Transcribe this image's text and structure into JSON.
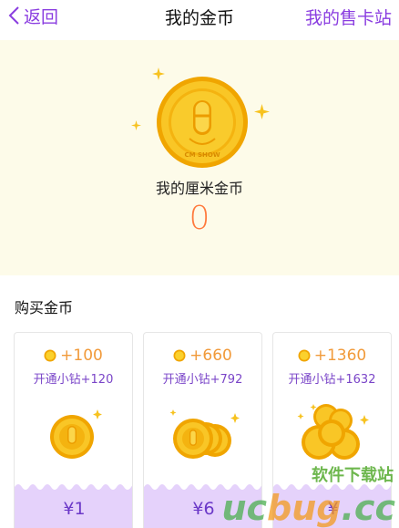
{
  "nav": {
    "back_label": "返回",
    "title": "我的金币",
    "right_label": "我的售卡站"
  },
  "hero": {
    "label": "我的厘米金币",
    "value": "0",
    "coin_text": "CM SHOW"
  },
  "section": {
    "title": "购买金币"
  },
  "cards": [
    {
      "amount": "+100",
      "sub": "开通小钻+120",
      "price": "¥1"
    },
    {
      "amount": "+660",
      "sub": "开通小钻+792",
      "price": "¥6"
    },
    {
      "amount": "+1360",
      "sub": "开通小钻+1632",
      "price": "¥"
    }
  ],
  "watermark": {
    "line1": "软件下载站",
    "line2_a": "uc",
    "line2_b": "bug",
    "line2_c": ".cc"
  },
  "colors": {
    "accent": "#8a3de0",
    "coin": "#f7c21f",
    "value": "#ff7a3d",
    "price_bg": "#e5d2fb"
  }
}
